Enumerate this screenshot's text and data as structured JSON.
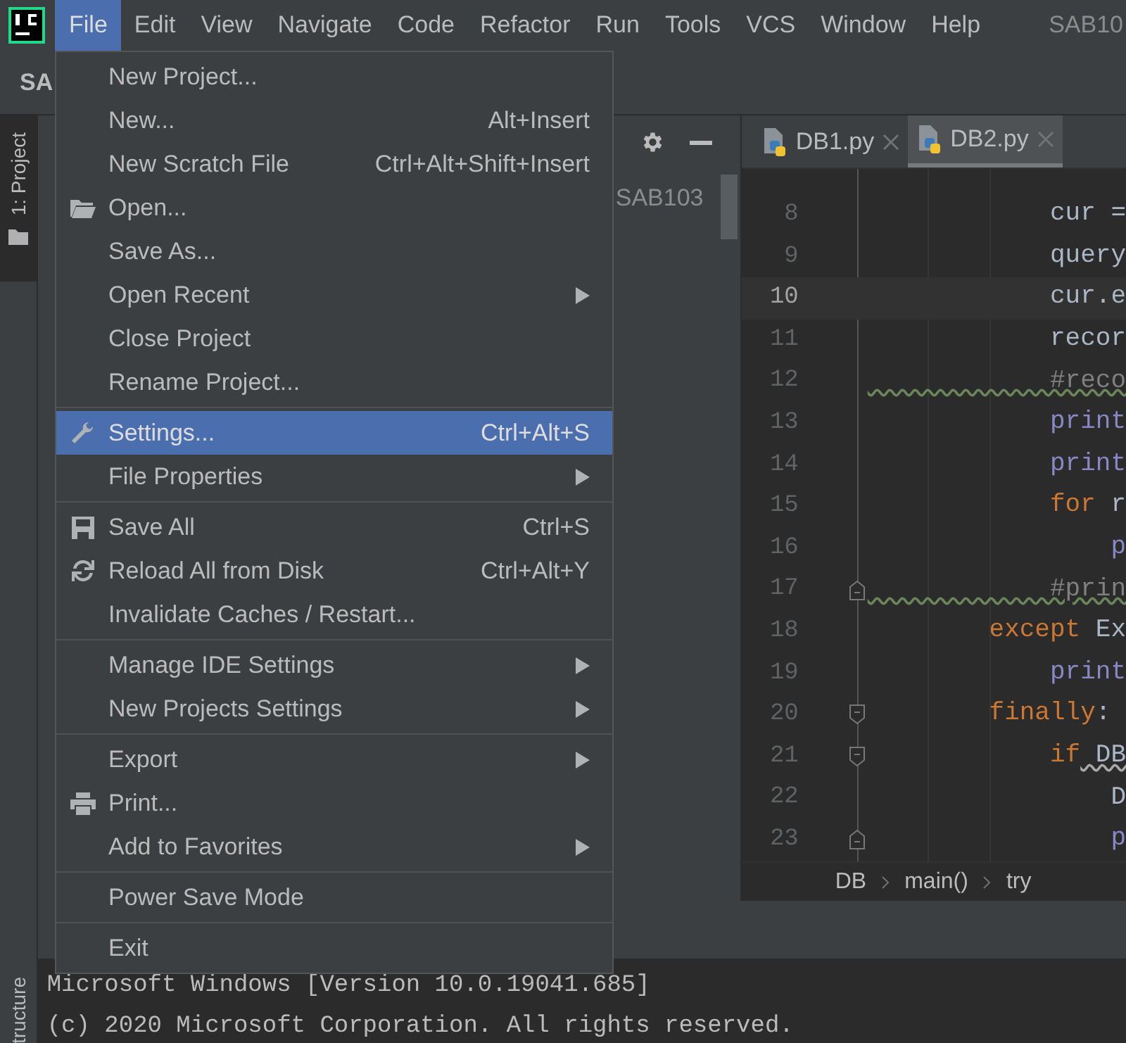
{
  "menu_bar": {
    "items": [
      {
        "label": "File",
        "selected": true
      },
      {
        "label": "Edit",
        "selected": false
      },
      {
        "label": "View",
        "selected": false
      },
      {
        "label": "Navigate",
        "selected": false
      },
      {
        "label": "Code",
        "selected": false
      },
      {
        "label": "Refactor",
        "selected": false
      },
      {
        "label": "Run",
        "selected": false
      },
      {
        "label": "Tools",
        "selected": false
      },
      {
        "label": "VCS",
        "selected": false
      },
      {
        "label": "Window",
        "selected": false
      },
      {
        "label": "Help",
        "selected": false
      }
    ],
    "window_title": "SAB10"
  },
  "toolbar": {
    "project_name": "SA"
  },
  "tool_strip": {
    "top_tab": {
      "label": "1: Project",
      "selected": true
    },
    "bottom_tab": {
      "label": "tructure"
    }
  },
  "project_panel": {
    "tree": [
      {
        "label": "SAB103"
      }
    ]
  },
  "file_menu": {
    "sections": [
      [
        {
          "label": "New Project...",
          "selected": false,
          "submenu": false
        },
        {
          "label": "New...",
          "shortcut": "Alt+Insert",
          "selected": false,
          "submenu": false
        },
        {
          "label": "New Scratch File",
          "shortcut": "Ctrl+Alt+Shift+Insert",
          "selected": false,
          "submenu": false
        },
        {
          "label": "Open...",
          "selected": false,
          "submenu": false
        },
        {
          "label": "Save As...",
          "selected": false,
          "submenu": false
        },
        {
          "label": "Open Recent",
          "selected": false,
          "submenu": true
        },
        {
          "label": "Close Project",
          "selected": false,
          "submenu": false
        },
        {
          "label": "Rename Project...",
          "selected": false,
          "submenu": false
        }
      ],
      [
        {
          "label": "Settings...",
          "shortcut": "Ctrl+Alt+S",
          "selected": true,
          "submenu": false
        },
        {
          "label": "File Properties",
          "selected": false,
          "submenu": true
        }
      ],
      [
        {
          "label": "Save All",
          "shortcut": "Ctrl+S",
          "selected": false,
          "submenu": false
        },
        {
          "label": "Reload All from Disk",
          "shortcut": "Ctrl+Alt+Y",
          "selected": false,
          "submenu": false
        },
        {
          "label": "Invalidate Caches / Restart...",
          "selected": false,
          "submenu": false
        }
      ],
      [
        {
          "label": "Manage IDE Settings",
          "selected": false,
          "submenu": true
        },
        {
          "label": "New Projects Settings",
          "selected": false,
          "submenu": true
        }
      ],
      [
        {
          "label": "Export",
          "selected": false,
          "submenu": true
        },
        {
          "label": "Print...",
          "selected": false,
          "submenu": false
        },
        {
          "label": "Add to Favorites",
          "selected": false,
          "submenu": true
        }
      ],
      [
        {
          "label": "Power Save Mode",
          "selected": false,
          "submenu": false
        }
      ],
      [
        {
          "label": "Exit",
          "selected": false,
          "submenu": false
        }
      ]
    ]
  },
  "editor": {
    "tabs": [
      {
        "label": "DB1.py",
        "selected": false
      },
      {
        "label": "DB2.py",
        "selected": true
      }
    ],
    "lines": [
      {
        "number": "8",
        "current": false,
        "tokens": [
          {
            "kind": "plain",
            "text": "            cur ="
          }
        ]
      },
      {
        "number": "9",
        "current": false,
        "tokens": [
          {
            "kind": "plain",
            "text": "            query"
          }
        ]
      },
      {
        "number": "10",
        "current": true,
        "tokens": [
          {
            "kind": "plain",
            "text": "            cur.e"
          }
        ]
      },
      {
        "number": "11",
        "current": false,
        "tokens": [
          {
            "kind": "plain",
            "text": "            recor"
          }
        ]
      },
      {
        "number": "12",
        "current": false,
        "tokens": [
          {
            "kind": "comment",
            "text": "            #reco"
          }
        ]
      },
      {
        "number": "13",
        "current": false,
        "tokens": [
          {
            "kind": "builtin",
            "text": "            print"
          }
        ]
      },
      {
        "number": "14",
        "current": false,
        "tokens": [
          {
            "kind": "builtin",
            "text": "            print"
          }
        ]
      },
      {
        "number": "15",
        "current": false,
        "tokens": [
          {
            "kind": "keyword",
            "text": "            for"
          },
          {
            "kind": "plain",
            "text": " r"
          }
        ]
      },
      {
        "number": "16",
        "current": false,
        "tokens": [
          {
            "kind": "builtin",
            "text": "                p"
          }
        ]
      },
      {
        "number": "17",
        "current": false,
        "tokens": [
          {
            "kind": "comment",
            "text": "            #prin"
          }
        ]
      },
      {
        "number": "18",
        "current": false,
        "tokens": [
          {
            "kind": "keyword",
            "text": "        except"
          },
          {
            "kind": "plain",
            "text": " Ex"
          }
        ]
      },
      {
        "number": "19",
        "current": false,
        "tokens": [
          {
            "kind": "builtin",
            "text": "            print"
          }
        ]
      },
      {
        "number": "20",
        "current": false,
        "tokens": [
          {
            "kind": "keyword",
            "text": "        finally"
          },
          {
            "kind": "plain",
            "text": ":"
          }
        ]
      },
      {
        "number": "21",
        "current": false,
        "tokens": [
          {
            "kind": "keyword",
            "text": "            if"
          },
          {
            "kind": "warning",
            "text": " DB"
          }
        ]
      },
      {
        "number": "22",
        "current": false,
        "tokens": [
          {
            "kind": "plain",
            "text": "                D"
          }
        ]
      },
      {
        "number": "23",
        "current": false,
        "tokens": [
          {
            "kind": "builtin",
            "text": "                p"
          }
        ]
      }
    ],
    "breadcrumb": [
      "DB",
      "main()",
      "try"
    ]
  },
  "terminal": {
    "lines": [
      "Microsoft Windows [Version 10.0.19041.685]",
      "(c) 2020 Microsoft Corporation. All rights reserved."
    ]
  }
}
